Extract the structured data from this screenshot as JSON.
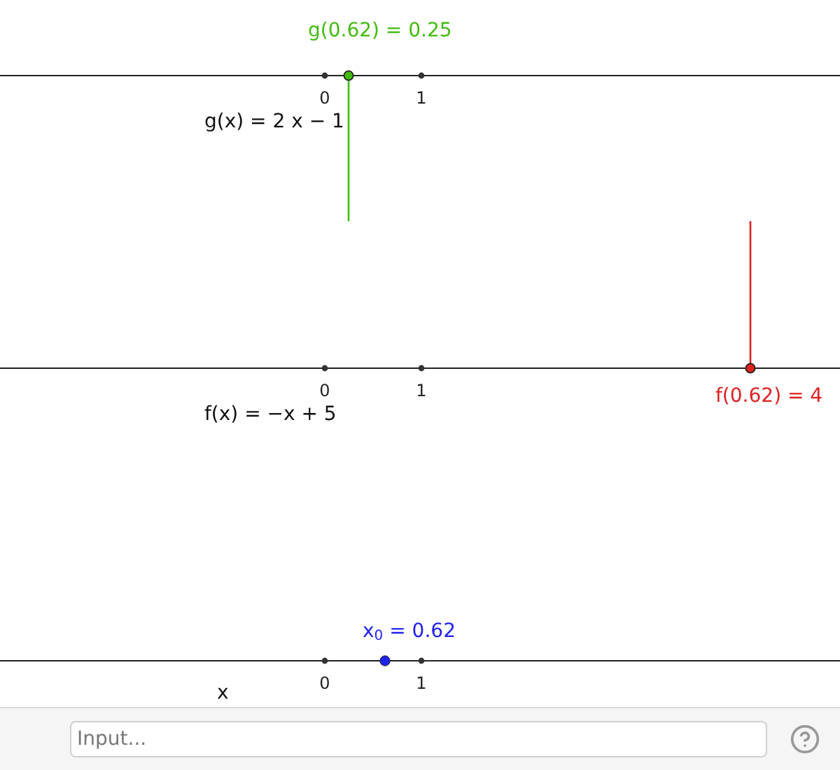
{
  "number_lines": [
    {
      "kind": "output",
      "color": "#44bb11",
      "value_label": "g(0.62) = 0.25",
      "function_label": "g(x) = 2 x − 1",
      "ticks": [
        "0",
        "1"
      ]
    },
    {
      "kind": "output",
      "color": "#dd2222",
      "value_label": "f(0.62) = 4",
      "function_label": "f(x) = −x + 5",
      "ticks": [
        "0",
        "1"
      ]
    },
    {
      "kind": "input",
      "color": "#2222ee",
      "value_label": "x$_{0}$ = 0.62",
      "function_label": "x",
      "ticks": [
        "0",
        "1"
      ]
    }
  ],
  "input_bar": {
    "placeholder": "Input..."
  }
}
